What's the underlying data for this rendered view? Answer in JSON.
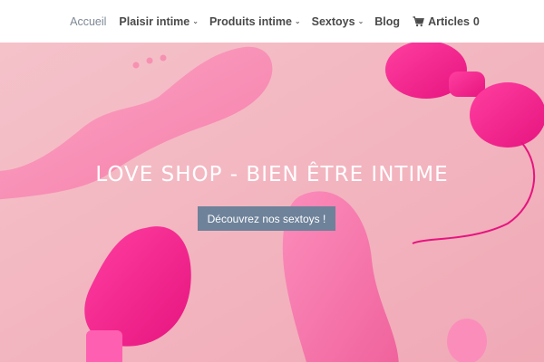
{
  "nav": {
    "items": [
      {
        "label": "Accueil",
        "has_dropdown": false
      },
      {
        "label": "Plaisir intime",
        "has_dropdown": true
      },
      {
        "label": "Produits intime",
        "has_dropdown": true
      },
      {
        "label": "Sextoys",
        "has_dropdown": true
      },
      {
        "label": "Blog",
        "has_dropdown": false
      }
    ],
    "cart": {
      "icon": "cart-icon",
      "label": "Articles",
      "count": "0"
    }
  },
  "hero": {
    "title": "LOVE SHOP - BIEN ÊTRE INTIME",
    "button_label": "Découvrez nos sextoys !",
    "colors": {
      "background": "#f3b9c2",
      "button": "#6e829a",
      "accent_pink": "#f0208e"
    }
  }
}
